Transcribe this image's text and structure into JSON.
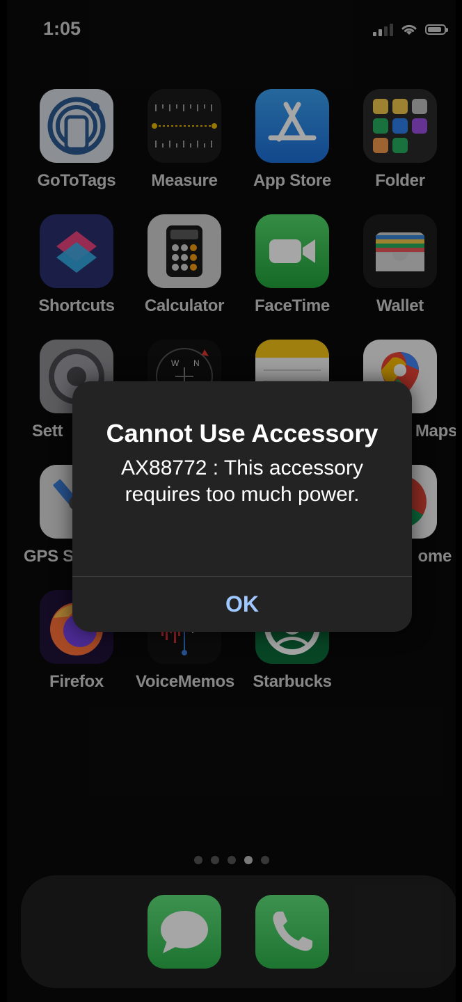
{
  "status_bar": {
    "time": "1:05"
  },
  "apps": [
    {
      "id": "gototags",
      "label": "GoToTags"
    },
    {
      "id": "measure",
      "label": "Measure"
    },
    {
      "id": "app-store",
      "label": "App Store"
    },
    {
      "id": "folder",
      "label": "Folder"
    },
    {
      "id": "shortcuts",
      "label": "Shortcuts"
    },
    {
      "id": "calculator",
      "label": "Calculator"
    },
    {
      "id": "facetime",
      "label": "FaceTime"
    },
    {
      "id": "wallet",
      "label": "Wallet"
    },
    {
      "id": "settings",
      "label": "Sett"
    },
    {
      "id": "compass",
      "label": ""
    },
    {
      "id": "notes",
      "label": ""
    },
    {
      "id": "maps",
      "label": "Maps"
    },
    {
      "id": "gps",
      "label": "GPS S"
    },
    {
      "id": "chrome",
      "label": "ome"
    },
    {
      "id": "firefox",
      "label": "Firefox"
    },
    {
      "id": "voice-memos",
      "label": "VoiceMemos"
    },
    {
      "id": "starbucks",
      "label": "Starbucks"
    }
  ],
  "page_dots": {
    "count": 5,
    "active_index": 3
  },
  "dock": [
    {
      "id": "messages",
      "icon": "messages-icon"
    },
    {
      "id": "phone",
      "icon": "phone-icon"
    }
  ],
  "alert": {
    "title": "Cannot Use Accessory",
    "message": "AX88772 : This accessory requires too much power.",
    "ok_label": "OK"
  },
  "colors": {
    "alert_button": "#9ec8ff",
    "alert_bg": "#232323"
  }
}
